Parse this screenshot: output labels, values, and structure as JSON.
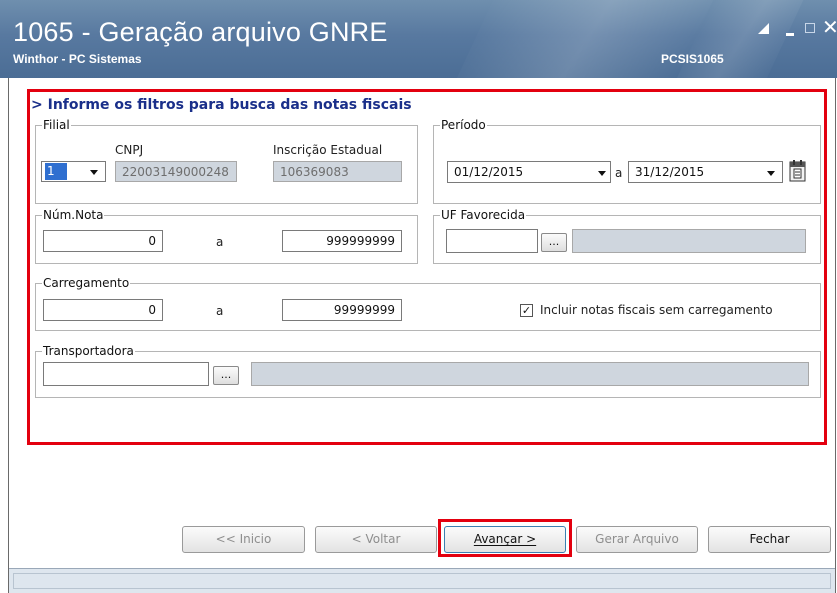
{
  "window": {
    "title": "1065 - Geração arquivo GNRE",
    "subtitle": "Winthor - PC Sistemas",
    "program_code": "PCSIS1065",
    "close_glyph": "✕"
  },
  "heading": "> Informe os filtros para busca das notas fiscais",
  "filial": {
    "legend": "Filial",
    "cnpj_label": "CNPJ",
    "ie_label": "Inscrição Estadual",
    "code": "1",
    "cnpj": "22003149000248",
    "ie": "106369083"
  },
  "periodo": {
    "legend": "Período",
    "start": "01/12/2015",
    "separator": "a",
    "end": "31/12/2015"
  },
  "num_nota": {
    "legend": "Núm.Nota",
    "from": "0",
    "separator": "a",
    "to": "999999999"
  },
  "uf_favorecida": {
    "legend": "UF Favorecida",
    "value": "",
    "lookup_label": "..."
  },
  "carregamento": {
    "legend": "Carregamento",
    "from": "0",
    "separator": "a",
    "to": "99999999",
    "checkbox_label": "Incluir notas fiscais sem carregamento",
    "checkbox_checked": true,
    "check_glyph": "✓"
  },
  "transportadora": {
    "legend": "Transportadora",
    "value": "",
    "lookup_label": "..."
  },
  "buttons": {
    "inicio": "<< Inicio",
    "voltar": "< Voltar",
    "avancar": "Avançar >",
    "gerar": "Gerar Arquivo",
    "fechar": "Fechar"
  },
  "colors": {
    "highlight": "#e3000f",
    "heading": "#1a2f8a",
    "titlebar": "#5879a0"
  }
}
